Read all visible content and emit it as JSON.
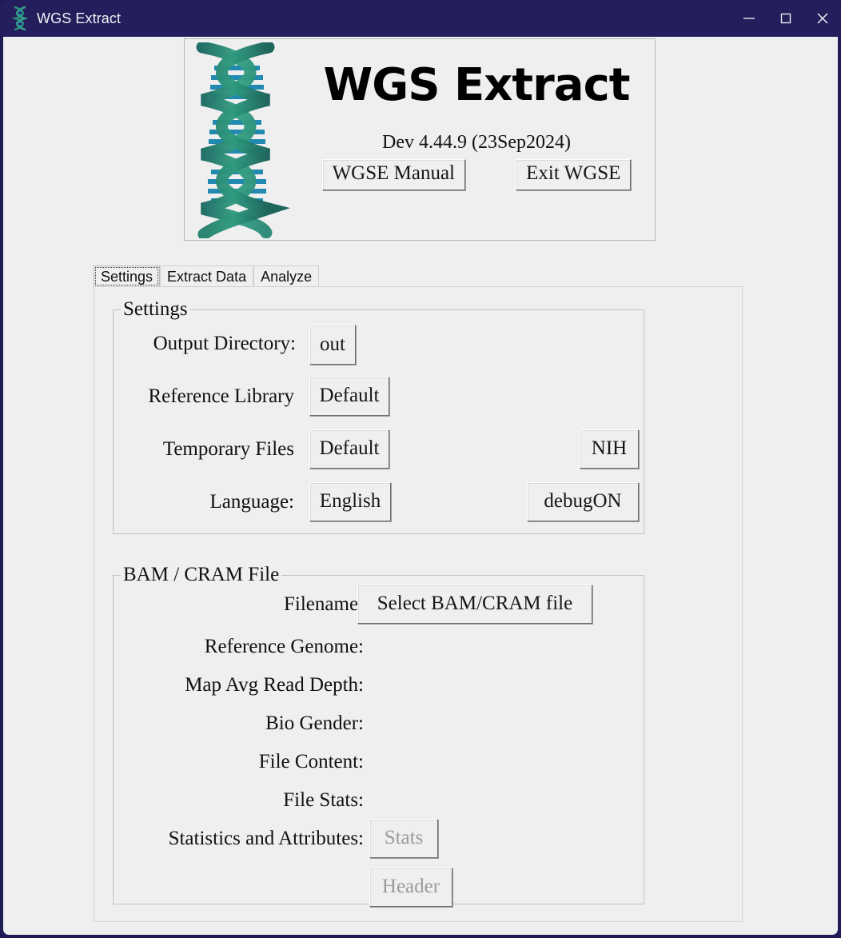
{
  "window": {
    "title": "WGS Extract",
    "icon": "dna-helix-icon",
    "accent_titlebar": "#241e5c",
    "body_bg": "#efefef",
    "controls": [
      {
        "name": "minimize",
        "glyph": "–"
      },
      {
        "name": "maximize",
        "glyph": "□"
      },
      {
        "name": "close",
        "glyph": "✕"
      }
    ]
  },
  "logo": {
    "image": "dna-double-helix-logo",
    "title": "WGS Extract",
    "version": "Dev 4.44.9 (23Sep2024)",
    "manual_button": "WGSE Manual",
    "exit_button": "Exit WGSE",
    "strand_color": "#2d8c78",
    "rung_color": "#1c87ad"
  },
  "tabs": [
    {
      "label": "Settings",
      "active": true
    },
    {
      "label": "Extract Data",
      "active": false
    },
    {
      "label": "Analyze",
      "active": false
    }
  ],
  "settings_group": {
    "title": "Settings",
    "rows": [
      {
        "label": "Output Directory:",
        "button": "out",
        "extra": null
      },
      {
        "label": "Reference Library",
        "button": "Default",
        "extra": null
      },
      {
        "label": "Temporary Files",
        "button": "Default",
        "extra": "NIH"
      },
      {
        "label": "Language:",
        "button": "English",
        "extra": "debugON"
      }
    ]
  },
  "bam_group": {
    "title": "BAM / CRAM File",
    "rows": [
      {
        "label": "Filename:",
        "value": "",
        "button": "Select BAM/CRAM file",
        "disabled": false
      },
      {
        "label": "Reference Genome:",
        "value": "",
        "button": null,
        "disabled": false
      },
      {
        "label": "Map Avg Read Depth:",
        "value": "",
        "button": null,
        "disabled": false
      },
      {
        "label": "Bio Gender:",
        "value": "",
        "button": null,
        "disabled": false
      },
      {
        "label": "File Content:",
        "value": "",
        "button": null,
        "disabled": false
      },
      {
        "label": "File Stats:",
        "value": "",
        "button": null,
        "disabled": false
      },
      {
        "label": "Statistics and Attributes:",
        "value": "",
        "button": "Stats",
        "disabled": true
      },
      {
        "label": "",
        "value": "",
        "button": "Header",
        "disabled": true
      }
    ]
  }
}
